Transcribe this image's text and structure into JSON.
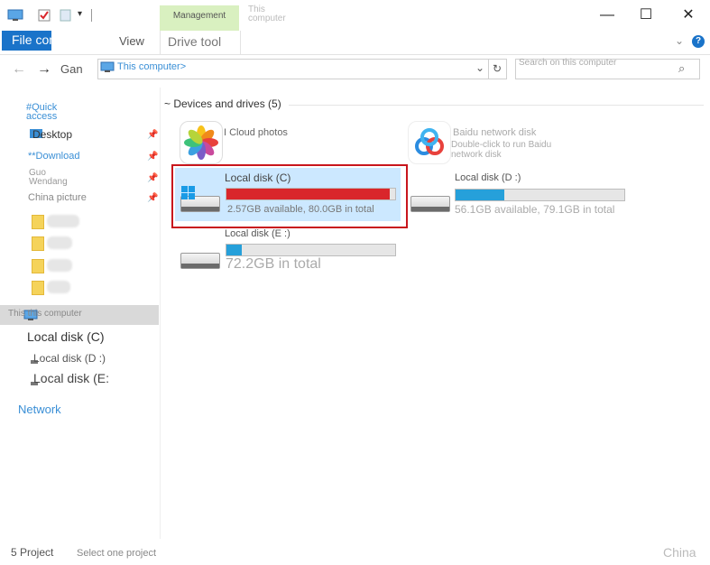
{
  "window": {
    "title": "This computer",
    "contextual_tab": "Management"
  },
  "ribbon": {
    "file_tab": "File computer",
    "view_tab": "View",
    "drive_tool_tab": "Drive tool"
  },
  "address": {
    "back_label": "Gan",
    "path": "This computer>",
    "search_placeholder": "Search on this computer"
  },
  "sidebar": {
    "quick_access": "#Quick access",
    "items": [
      {
        "label": "Desktop",
        "pinned": true
      },
      {
        "label": "**Download",
        "pinned": true
      },
      {
        "label": "Guo Wendang",
        "pinned": true
      },
      {
        "label": "China picture",
        "pinned": true
      }
    ],
    "this_computer": "This this computer",
    "drives": [
      "Local disk (C)",
      "Local disk (D :)",
      "Local disk (E:"
    ],
    "network": "Network"
  },
  "content": {
    "section_header": "~ Devices and drives (5)",
    "apps": [
      {
        "name": "I Cloud photos",
        "icon": "icloud-photos-icon"
      },
      {
        "name": "Baidu network disk",
        "subtitle": "Double-click to run Baidu network disk",
        "icon": "baidu-netdisk-icon"
      }
    ],
    "drives": [
      {
        "name": "Local disk (C)",
        "free_text": "2.57GB available, 80.0GB in total",
        "used_fraction": 0.97,
        "bar_color": "#d9262b",
        "selected": true
      },
      {
        "name": "Local disk (D :)",
        "free_text": "56.1GB available, 79.1GB in total",
        "used_fraction": 0.29,
        "bar_color": "#26a0da",
        "selected": false
      },
      {
        "name": "Local disk (E :)",
        "free_text": "72.2GB in total",
        "used_fraction": 0.09,
        "bar_color": "#26a0da",
        "selected": false
      }
    ]
  },
  "status": {
    "count": "5 Project",
    "selection": "Select one project",
    "region": "China"
  },
  "colors": {
    "accent": "#1a73c9",
    "selection_border": "#c8161d",
    "selection_fill": "#cce8ff",
    "management_tab": "#d9f0c0"
  }
}
